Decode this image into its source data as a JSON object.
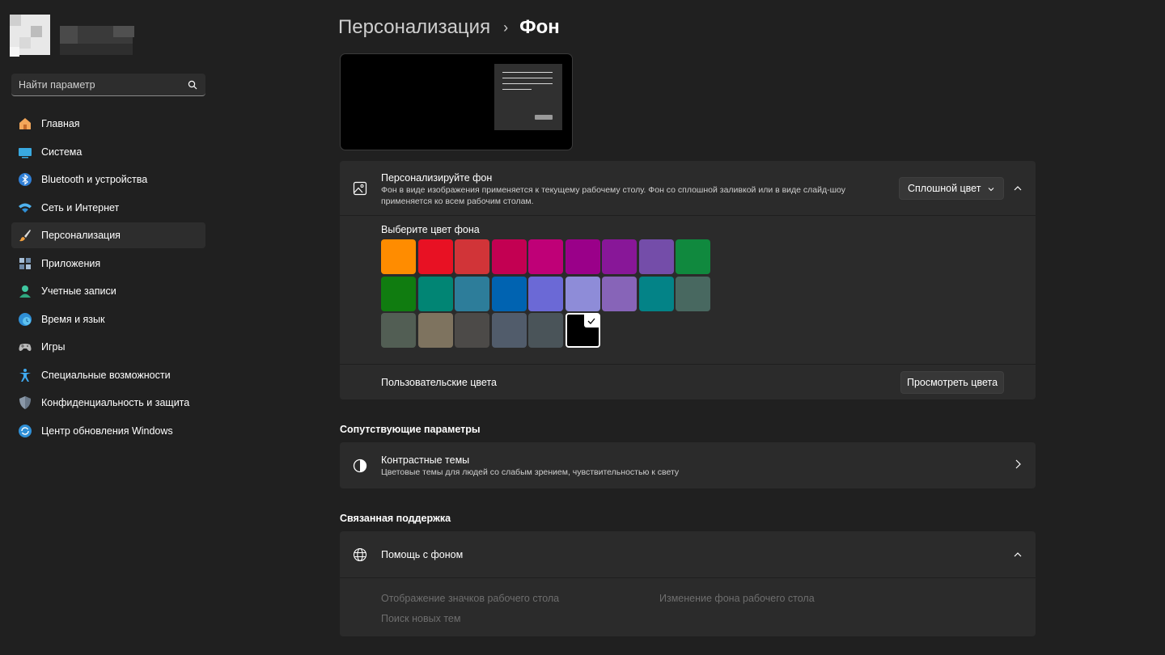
{
  "sidebar": {
    "search_placeholder": "Найти параметр",
    "items": [
      {
        "label": "Главная",
        "icon": "home-icon"
      },
      {
        "label": "Система",
        "icon": "system-display-icon"
      },
      {
        "label": "Bluetooth и устройства",
        "icon": "bluetooth-icon"
      },
      {
        "label": "Сеть и Интернет",
        "icon": "wifi-icon"
      },
      {
        "label": "Персонализация",
        "icon": "brush-icon",
        "active": true
      },
      {
        "label": "Приложения",
        "icon": "apps-icon"
      },
      {
        "label": "Учетные записи",
        "icon": "account-icon"
      },
      {
        "label": "Время и язык",
        "icon": "globe-clock-icon"
      },
      {
        "label": "Игры",
        "icon": "gamepad-icon"
      },
      {
        "label": "Специальные возможности",
        "icon": "accessibility-icon"
      },
      {
        "label": "Конфиденциальность и защита",
        "icon": "shield-icon"
      },
      {
        "label": "Центр обновления Windows",
        "icon": "update-icon"
      }
    ]
  },
  "breadcrumb": {
    "parent": "Персонализация",
    "separator": "›",
    "current": "Фон"
  },
  "personalize": {
    "title": "Персонализируйте фон",
    "description_line1": "Фон в виде изображения применяется к текущему рабочему столу. Фон со сплошной заливкой или в виде слайд-шоу",
    "description_line2": "применяется ко всем рабочим столам.",
    "dropdown_value": "Сплошной цвет",
    "colors_label": "Выберите цвет фона",
    "colors": [
      "#ff8c00",
      "#e81123",
      "#d13438",
      "#c30052",
      "#bf0077",
      "#9a0089",
      "#881798",
      "#744da9",
      "#10893e",
      "#107c10",
      "#018574",
      "#2d7d9a",
      "#0063b1",
      "#6b69d6",
      "#8e8cd8",
      "#8764b8",
      "#038387",
      "#486860",
      "#525e54",
      "#7e735f",
      "#4c4a48",
      "#515c6b",
      "#4a5459",
      "#000000"
    ],
    "selected_color": "#000000",
    "custom_colors_label": "Пользовательские цвета",
    "view_colors_button": "Просмотреть цвета"
  },
  "related": {
    "section_title": "Сопутствующие параметры",
    "contrast_title": "Контрастные темы",
    "contrast_desc": "Цветовые темы для людей со слабым зрением, чувствительностью к свету"
  },
  "support": {
    "section_title": "Связанная поддержка",
    "help_title": "Помощь с фоном",
    "links": [
      "Отображение значков рабочего стола",
      "Изменение фона рабочего стола",
      "Поиск новых тем"
    ]
  },
  "accent_color": "#0078d4"
}
